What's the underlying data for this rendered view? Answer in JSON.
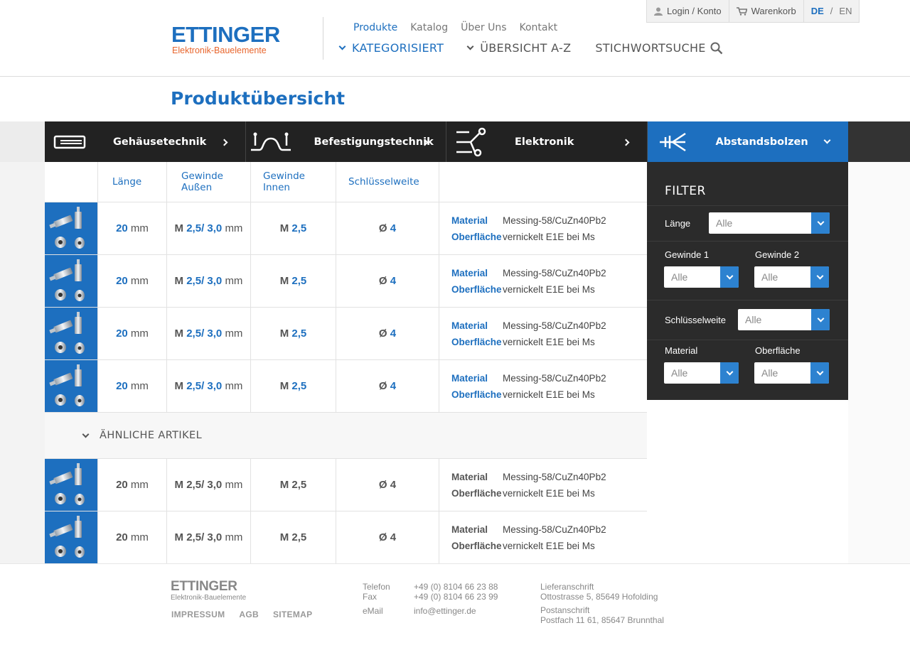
{
  "brand": {
    "name": "ETTINGER",
    "tagline": "Elektronik-Bauelemente",
    "primary_color": "#1d6fbf",
    "accent_color": "#e8652c"
  },
  "topbar": {
    "login_label": "Login / Konto",
    "cart_label": "Warenkorb",
    "lang_de": "DE",
    "lang_sep": "/",
    "lang_en": "EN"
  },
  "subnav": [
    {
      "label": "Produkte"
    },
    {
      "label": "Katalog"
    },
    {
      "label": "Über Uns"
    },
    {
      "label": "Kontakt"
    }
  ],
  "mainnav": {
    "kategorisiert": "KATEGORISIERT",
    "uebersicht": "ÜBERSICHT A-Z",
    "stichwort": "STICHWORTSUCHE"
  },
  "page_title": "Produktübersicht",
  "categories": [
    {
      "label": "Gehäusetechnik",
      "icon": "enclosure-icon"
    },
    {
      "label": "Befestigungstechnik",
      "icon": "fastener-icon"
    },
    {
      "label": "Elektronik",
      "icon": "circuit-icon"
    },
    {
      "label": "Abstandsbolzen",
      "icon": "standoff-icon"
    }
  ],
  "table": {
    "headers": {
      "laenge": "Länge",
      "gewinde_aussen_1": "Gewinde",
      "gewinde_aussen_2": "Außen",
      "gewinde_innen_1": "Gewinde",
      "gewinde_innen_2": "Innen",
      "schluesselweite": "Schlüsselweite"
    },
    "rows": [
      {
        "laenge": "20",
        "laenge_unit": "mm",
        "ga_prefix": "M",
        "ga_value": "2,5/ 3,0",
        "ga_unit": "mm",
        "gi_prefix": "M",
        "gi_value": "2,5",
        "sw_prefix": "Ø",
        "sw_value": "4",
        "material_label": "Material",
        "material_value": "Messing-58/CuZn40Pb2",
        "oberflaeche_label": "Oberfläche",
        "oberflaeche_value": "vernickelt E1E bei Ms"
      },
      {
        "laenge": "20",
        "laenge_unit": "mm",
        "ga_prefix": "M",
        "ga_value": "2,5/ 3,0",
        "ga_unit": "mm",
        "gi_prefix": "M",
        "gi_value": "2,5",
        "sw_prefix": "Ø",
        "sw_value": "4",
        "material_label": "Material",
        "material_value": "Messing-58/CuZn40Pb2",
        "oberflaeche_label": "Oberfläche",
        "oberflaeche_value": "vernickelt E1E bei Ms"
      },
      {
        "laenge": "20",
        "laenge_unit": "mm",
        "ga_prefix": "M",
        "ga_value": "2,5/ 3,0",
        "ga_unit": "mm",
        "gi_prefix": "M",
        "gi_value": "2,5",
        "sw_prefix": "Ø",
        "sw_value": "4",
        "material_label": "Material",
        "material_value": "Messing-58/CuZn40Pb2",
        "oberflaeche_label": "Oberfläche",
        "oberflaeche_value": "vernickelt E1E bei Ms"
      },
      {
        "laenge": "20",
        "laenge_unit": "mm",
        "ga_prefix": "M",
        "ga_value": "2,5/ 3,0",
        "ga_unit": "mm",
        "gi_prefix": "M",
        "gi_value": "2,5",
        "sw_prefix": "Ø",
        "sw_value": "4",
        "material_label": "Material",
        "material_value": "Messing-58/CuZn40Pb2",
        "oberflaeche_label": "Oberfläche",
        "oberflaeche_value": "vernickelt E1E bei Ms"
      }
    ],
    "similar_label": "ÄHNLICHE ARTIKEL",
    "similar_rows": [
      {
        "laenge": "20",
        "laenge_unit": "mm",
        "ga_prefix": "M",
        "ga_value": "2,5/ 3,0",
        "ga_unit": "mm",
        "gi_prefix": "M",
        "gi_value": "2,5",
        "sw_prefix": "Ø",
        "sw_value": "4",
        "material_label": "Material",
        "material_value": "Messing-58/CuZn40Pb2",
        "oberflaeche_label": "Oberfläche",
        "oberflaeche_value": "vernickelt E1E bei Ms"
      },
      {
        "laenge": "20",
        "laenge_unit": "mm",
        "ga_prefix": "M",
        "ga_value": "2,5/ 3,0",
        "ga_unit": "mm",
        "gi_prefix": "M",
        "gi_value": "2,5",
        "sw_prefix": "Ø",
        "sw_value": "4",
        "material_label": "Material",
        "material_value": "Messing-58/CuZn40Pb2",
        "oberflaeche_label": "Oberfläche",
        "oberflaeche_value": "vernickelt E1E bei Ms"
      }
    ]
  },
  "filter": {
    "title": "FILTER",
    "laenge_label": "Länge",
    "laenge_value": "Alle",
    "gewinde1_label": "Gewinde 1",
    "gewinde1_value": "Alle",
    "gewinde2_label": "Gewinde 2",
    "gewinde2_value": "Alle",
    "schluesselweite_label": "Schlüsselweite",
    "schluesselweite_value": "Alle",
    "material_label": "Material",
    "material_value": "Alle",
    "oberflaeche_label": "Oberfläche",
    "oberflaeche_value": "Alle"
  },
  "footer": {
    "logo_main": "ETTINGER",
    "logo_sub": "Elektronik-Bauelemente",
    "links": {
      "impressum": "IMPRESSUM",
      "agb": "AGB",
      "sitemap": "SITEMAP"
    },
    "telefon_label": "Telefon",
    "telefon_value": "+49 (0) 8104 66 23 88",
    "fax_label": "Fax",
    "fax_value": "+49 (0) 8104 66 23 99",
    "email_label": "eMail",
    "email_value": "info@ettinger.de",
    "liefer_label": "Lieferanschrift",
    "liefer_value": "Ottostrasse 5, 85649 Hofolding",
    "post_label": "Postanschrift",
    "post_value": "Postfach 11 61, 85647 Brunnthal"
  }
}
